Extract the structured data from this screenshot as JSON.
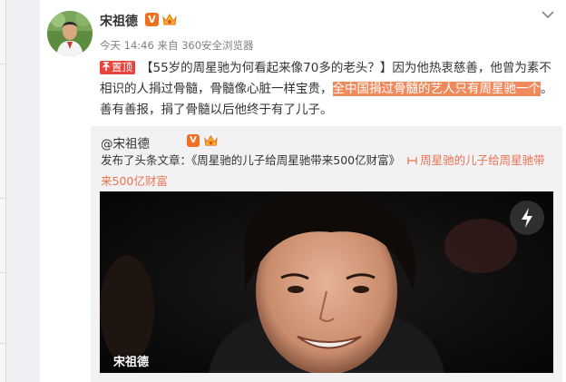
{
  "colors": {
    "page_bg": "#eef0f3",
    "card_bg": "#ffffff",
    "accent_orange": "#f0701f",
    "link_orange": "#eb7350",
    "highlight": "#ef8a5c",
    "pin_red": "#e8443f",
    "meta_gray": "#808080"
  },
  "post": {
    "avatar_icon": "user-avatar",
    "username": "宋祖德",
    "verified_icon": "verified-v-icon",
    "member_icon": "vip-crown-icon",
    "meta": "今天 14:46 来自 360安全浏览器",
    "menu_icon": "chevron-down-icon",
    "pin_label": "置顶",
    "text_part1": "【55岁的周星驰为何看起来像70多的老头？】因为他热衷慈善，他曾为素不相识的人捐过骨髓，骨髓像心脏一样宝贵，",
    "text_highlight": "全中国捐过骨髓的艺人只有周星驰一个",
    "text_part2": "。善有善报，捐了骨髓以后他终于有了儿子。"
  },
  "repost": {
    "author": "@宋祖德",
    "body_prefix": "发布了头条文章：《周星驰的儿子给周星驰带来500亿财富》",
    "link_icon": "article-link-icon",
    "link_text": "周星驰的儿子给周星驰带来500亿财富",
    "image": {
      "action_icon": "lightning-bolt-icon",
      "watermark": "宋祖德"
    }
  }
}
